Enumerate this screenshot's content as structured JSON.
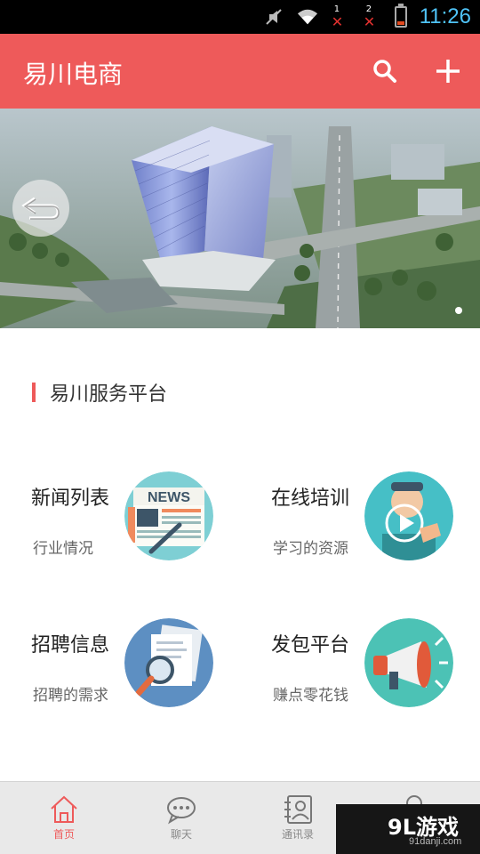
{
  "status_bar": {
    "sim1_number": "1",
    "sim2_number": "2",
    "time": "11:26",
    "icons": [
      "mute-icon",
      "wifi-icon",
      "signal-sim1-icon",
      "signal-sim2-icon",
      "battery-icon"
    ],
    "battery_level": 0.2
  },
  "app_bar": {
    "title": "易川电商",
    "icons": [
      "search-icon",
      "add-icon"
    ]
  },
  "banner": {
    "slide_count": 1,
    "active_slide": 1
  },
  "section": {
    "title": "易川服务平台"
  },
  "services": [
    {
      "title": "新闻列表",
      "subtitle": "行业情况",
      "icon": "news-icon",
      "bg_color": "#7ecfd4"
    },
    {
      "title": "在线培训",
      "subtitle": "学习的资源",
      "icon": "training-video-icon",
      "bg_color": "#46bfc6"
    },
    {
      "title": "招聘信息",
      "subtitle": "招聘的需求",
      "icon": "recruit-document-icon",
      "bg_color": "#5d8fc2"
    },
    {
      "title": "发包平台",
      "subtitle": "赚点零花钱",
      "icon": "megaphone-icon",
      "bg_color": "#4cc2b5"
    }
  ],
  "news_icon_text": "NEWS",
  "bottom_nav": {
    "items": [
      {
        "label": "首页",
        "icon": "home-icon",
        "active": true
      },
      {
        "label": "聊天",
        "icon": "chat-icon",
        "active": false
      },
      {
        "label": "通讯录",
        "icon": "contacts-icon",
        "active": false
      }
    ]
  },
  "watermark": {
    "logo": "9L游戏",
    "url": "91danji.com"
  },
  "colors": {
    "accent": "#ee5a5a",
    "status_bar": "#000000",
    "clock": "#4fc3f7",
    "nav_background": "#e9e9e9"
  }
}
